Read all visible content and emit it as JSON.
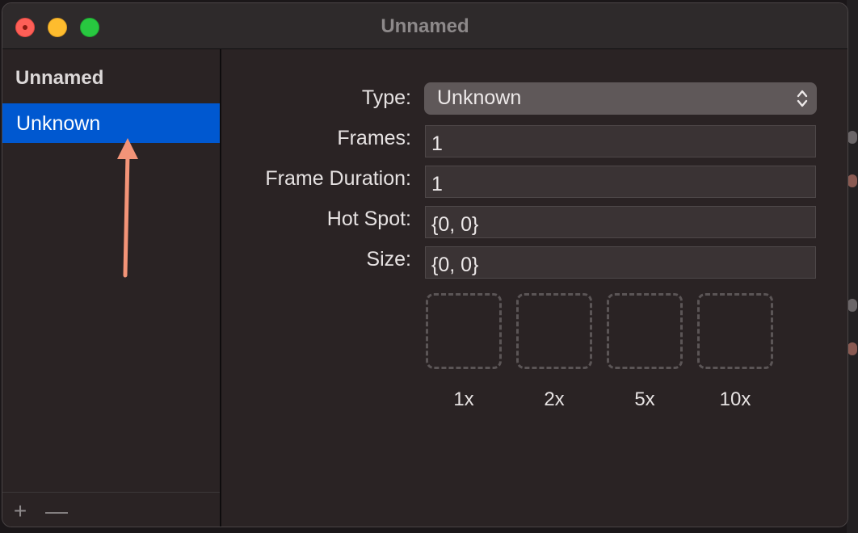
{
  "window": {
    "title": "Unnamed"
  },
  "sidebar": {
    "header": "Unnamed",
    "items": [
      {
        "label": "Unknown",
        "selected": true
      }
    ],
    "footer": {
      "add_label": "+",
      "remove_label": "—"
    }
  },
  "form": {
    "type_label": "Type:",
    "type_value": "Unknown",
    "frames_label": "Frames:",
    "frames_value": "1",
    "frame_duration_label": "Frame Duration:",
    "frame_duration_value": "1",
    "hot_spot_label": "Hot Spot:",
    "hot_spot_value": "{0, 0}",
    "size_label": "Size:",
    "size_value": "{0, 0}"
  },
  "previews": [
    {
      "label": "1x"
    },
    {
      "label": "2x"
    },
    {
      "label": "5x"
    },
    {
      "label": "10x"
    }
  ],
  "colors": {
    "selection": "#0058d0",
    "annotation_arrow": "#f39478",
    "window_background": "#2a2324"
  },
  "icons": {
    "close": "close-icon",
    "minimize": "minimize-icon",
    "zoom": "zoom-icon",
    "popup_chevron": "up-down-chevron-icon",
    "add": "plus-icon",
    "remove": "minus-icon",
    "annotation": "arrow-up-icon"
  }
}
